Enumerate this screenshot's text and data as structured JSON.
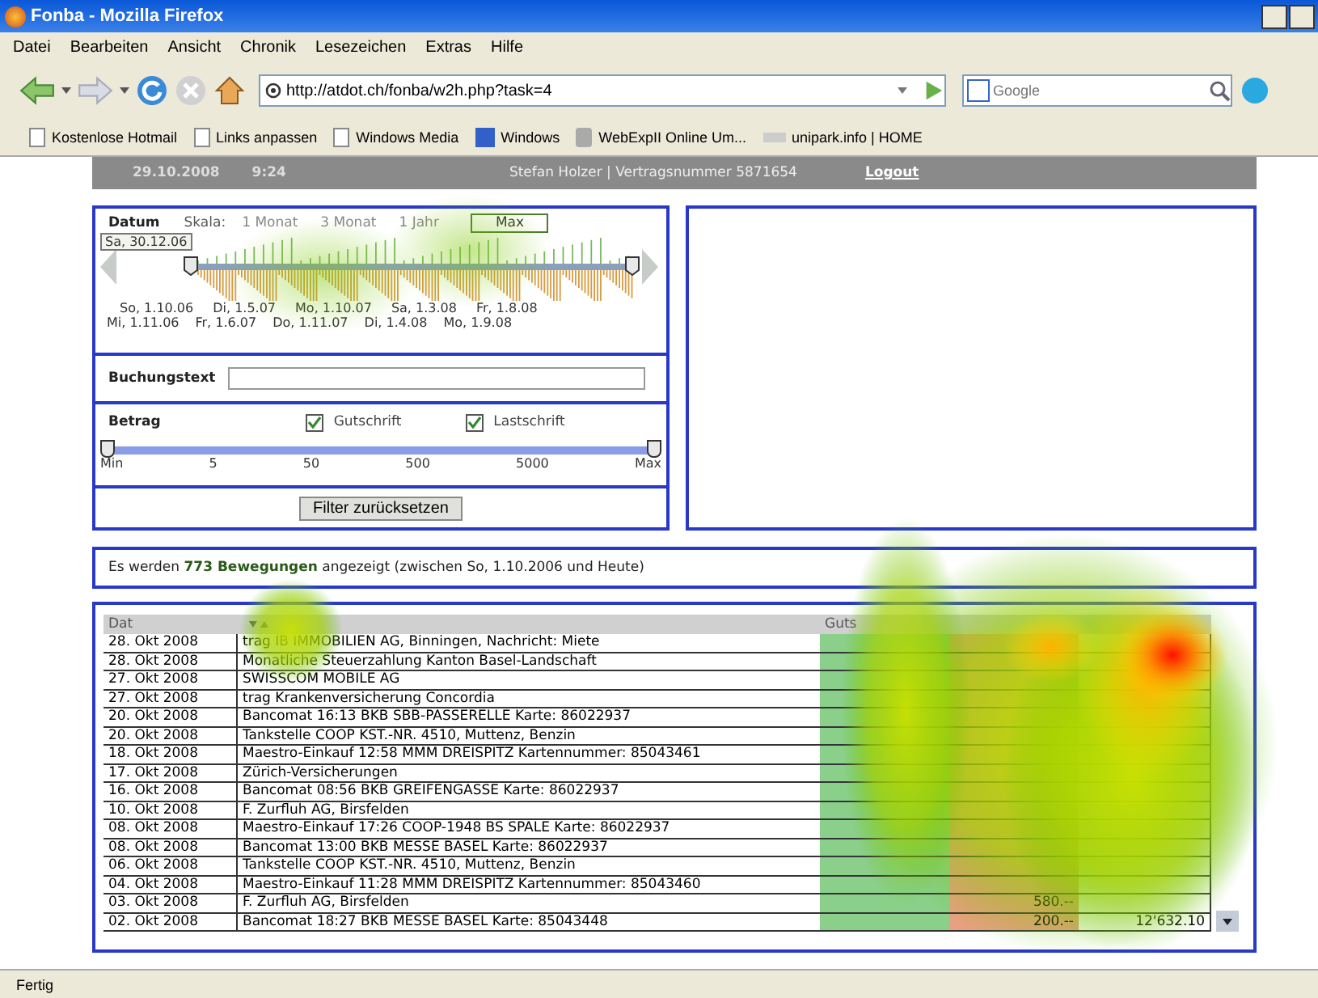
{
  "window": {
    "title": "Fonba - Mozilla Firefox"
  },
  "menu": [
    "Datei",
    "Bearbeiten",
    "Ansicht",
    "Chronik",
    "Lesezeichen",
    "Extras",
    "Hilfe"
  ],
  "address": {
    "value": "http://atdot.ch/fonba/w2h.php?task=4"
  },
  "search": {
    "placeholder": "Google"
  },
  "bookmarks": [
    {
      "label": "Kostenlose Hotmail",
      "kind": "page"
    },
    {
      "label": "Links anpassen",
      "kind": "page"
    },
    {
      "label": "Windows Media",
      "kind": "page"
    },
    {
      "label": "Windows",
      "kind": "m"
    },
    {
      "label": "WebExpII Online Um...",
      "kind": "app"
    },
    {
      "label": "unipark.info | HOME",
      "kind": "link"
    }
  ],
  "header": {
    "date": "29.10.2008",
    "time": "9:24",
    "user": "Stefan Holzer | Vertragsnummer 5871654",
    "logout": "Logout"
  },
  "date_filter": {
    "label": "Datum",
    "scale_label": "Skala:",
    "scales": [
      {
        "label": "1 Monat",
        "selected": false
      },
      {
        "label": "3 Monat",
        "selected": false
      },
      {
        "label": "1 Jahr",
        "selected": false
      },
      {
        "label": "Max",
        "selected": true
      }
    ],
    "start_badge": "Sa, 30.12.06",
    "ticks_top": [
      "So, 1.10.06",
      "Di, 1.5.07",
      "Mo, 1.10.07",
      "Sa, 1.3.08",
      "Fr, 1.8.08"
    ],
    "ticks_bottom": [
      "Mi, 1.11.06",
      "Fr, 1.6.07",
      "Do, 1.11.07",
      "Di, 1.4.08",
      "Mo, 1.9.08"
    ]
  },
  "text_filter": {
    "label": "Buchungstext"
  },
  "amount_filter": {
    "label": "Betrag",
    "level": 1,
    "checks": [
      {
        "label": "Gutschrift",
        "checked": true
      },
      {
        "label": "Lastschrift",
        "checked": true
      }
    ],
    "ticks": [
      "Min",
      "5",
      "50",
      "500",
      "5000",
      "Max"
    ]
  },
  "reset_button": "Filter zurücksetzen",
  "summary": "Es werden **773 Bewegungen** angezeigt (zwischen So, 1.10.2006 und Heute)",
  "table": {
    "columns": [
      "Dat",
      "",
      "Guts",
      "",
      ""
    ],
    "rows": [
      {
        "date": "28. Okt 2008",
        "text": "trag IB IMMOBILIEN AG, Binningen, Nachricht: Miete",
        "debit": "",
        "balance": ""
      },
      {
        "date": "28. Okt 2008",
        "text": "Monatliche Steuerzahlung Kanton Basel-Landschaft",
        "debit": "",
        "balance": ""
      },
      {
        "date": "27. Okt 2008",
        "text": "SWISSCOM MOBILE AG",
        "debit": "",
        "balance": ""
      },
      {
        "date": "27. Okt 2008",
        "text": "trag Krankenversicherung Concordia",
        "debit": "",
        "balance": ""
      },
      {
        "date": "20. Okt 2008",
        "text": "Bancomat 16:13 BKB SBB-PASSERELLE Karte: 86022937",
        "debit": "",
        "balance": ""
      },
      {
        "date": "20. Okt 2008",
        "text": "Tankstelle COOP KST.-NR. 4510, Muttenz, Benzin",
        "debit": "",
        "balance": ""
      },
      {
        "date": "18. Okt 2008",
        "text": "Maestro-Einkauf 12:58 MMM DREISPITZ Kartennummer: 85043461",
        "debit": "",
        "balance": ""
      },
      {
        "date": "17. Okt 2008",
        "text": "Zürich-Versicherungen",
        "debit": "",
        "balance": ""
      },
      {
        "date": "16. Okt 2008",
        "text": "Bancomat 08:56 BKB GREIFENGASSE Karte: 86022937",
        "debit": "",
        "balance": ""
      },
      {
        "date": "10. Okt 2008",
        "text": "F. Zurfluh AG, Birsfelden",
        "debit": "",
        "balance": ""
      },
      {
        "date": "08. Okt 2008",
        "text": "Maestro-Einkauf 17:26 COOP-1948 BS SPALE Karte: 86022937",
        "debit": "",
        "balance": ""
      },
      {
        "date": "08. Okt 2008",
        "text": "Bancomat 13:00 BKB MESSE BASEL Karte: 86022937",
        "debit": "",
        "balance": ""
      },
      {
        "date": "06. Okt 2008",
        "text": "Tankstelle COOP KST.-NR. 4510, Muttenz, Benzin",
        "debit": "",
        "balance": ""
      },
      {
        "date": "04. Okt 2008",
        "text": "Maestro-Einkauf 11:28 MMM DREISPITZ Kartennummer: 85043460",
        "debit": "",
        "balance": ""
      },
      {
        "date": "03. Okt 2008",
        "text": "F. Zurfluh AG, Birsfelden",
        "debit": "580.--",
        "balance": ""
      },
      {
        "date": "02. Okt 2008",
        "text": "Bancomat 18:27 BKB MESSE BASEL Karte: 85043448",
        "debit": "200.--",
        "balance": "12'632.10"
      }
    ]
  },
  "status_bar": "Fertig"
}
